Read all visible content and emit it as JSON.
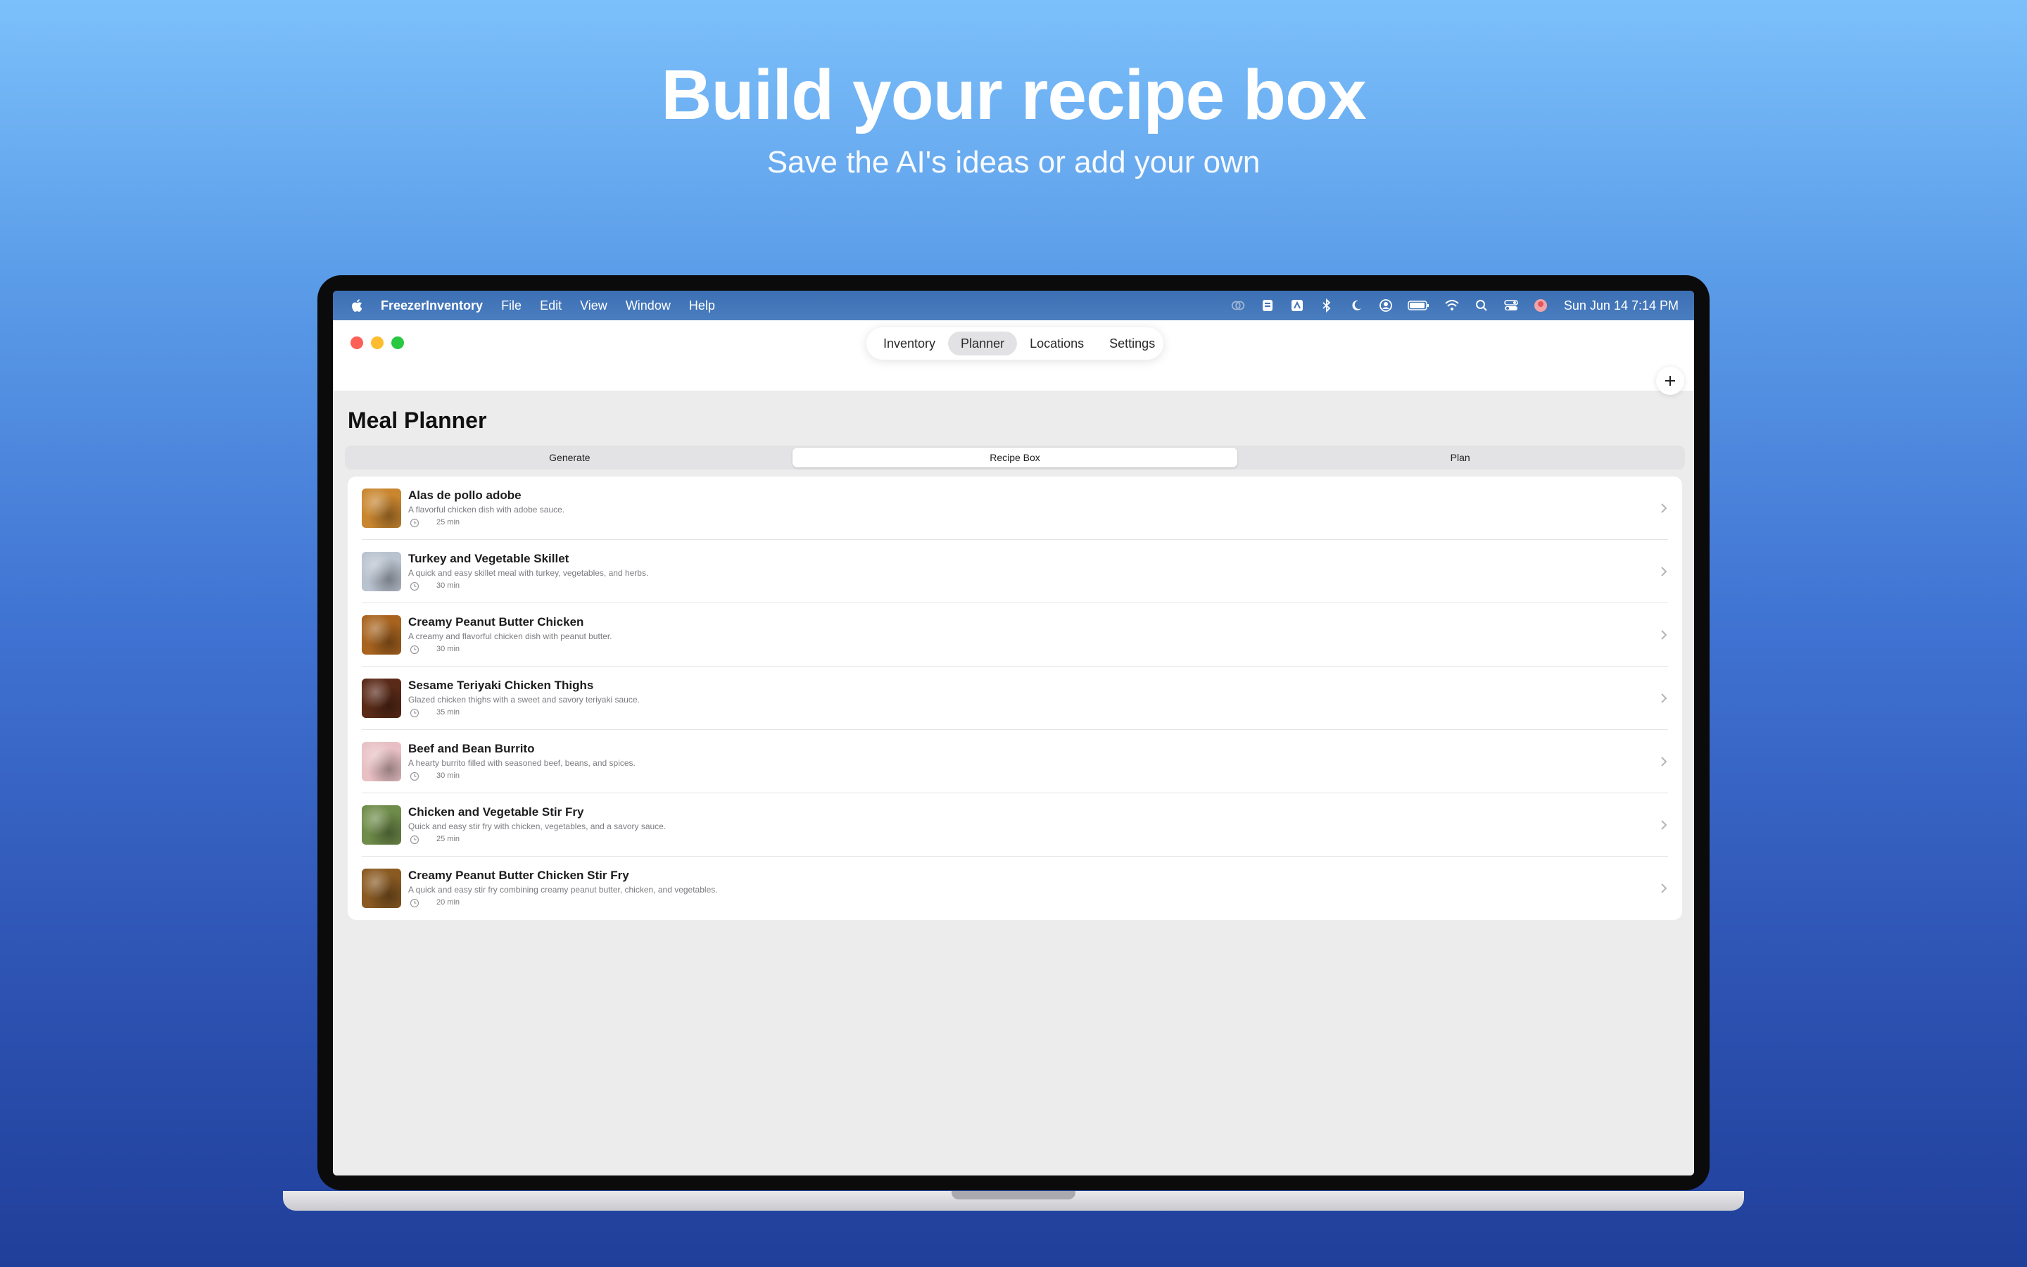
{
  "hero": {
    "title": "Build your recipe box",
    "subtitle": "Save the AI's ideas or add your own"
  },
  "menubar": {
    "app_name": "FreezerInventory",
    "menus": [
      "File",
      "Edit",
      "View",
      "Window",
      "Help"
    ],
    "status_icons": [
      "privacy-icon",
      "shield-icon",
      "app-store-icon",
      "bluetooth-icon",
      "moon-icon",
      "user-icon",
      "battery-icon",
      "wifi-icon",
      "search-icon",
      "control-center-icon",
      "avatar-icon"
    ],
    "clock": "Sun Jun 14  7:14 PM"
  },
  "nav": {
    "tabs": [
      "Inventory",
      "Planner",
      "Locations",
      "Settings"
    ],
    "active_tab": "Planner"
  },
  "page": {
    "title": "Meal Planner"
  },
  "picker": {
    "options": [
      "Generate",
      "Recipe Box",
      "Plan"
    ],
    "selected": "Recipe Box"
  },
  "recipes": [
    {
      "title": "Alas de pollo adobe",
      "description": "A flavorful chicken dish with adobe sauce.",
      "time": "25 min",
      "thumb_color": "#c9862f"
    },
    {
      "title": "Turkey and Vegetable Skillet",
      "description": "A quick and easy skillet meal with turkey, vegetables, and herbs.",
      "time": "30 min",
      "thumb_color": "#b9c2cf"
    },
    {
      "title": "Creamy Peanut Butter Chicken",
      "description": "A creamy and flavorful chicken dish with peanut butter.",
      "time": "30 min",
      "thumb_color": "#a8641f"
    },
    {
      "title": "Sesame Teriyaki Chicken Thighs",
      "description": "Glazed chicken thighs with a sweet and savory teriyaki sauce.",
      "time": "35 min",
      "thumb_color": "#5a2a18"
    },
    {
      "title": "Beef and Bean Burrito",
      "description": "A hearty burrito filled with seasoned beef, beans, and spices.",
      "time": "30 min",
      "thumb_color": "#e8c0c4"
    },
    {
      "title": "Chicken and Vegetable Stir Fry",
      "description": "Quick and easy stir fry with chicken, vegetables, and a savory sauce.",
      "time": "25 min",
      "thumb_color": "#6f8c4a"
    },
    {
      "title": "Creamy Peanut Butter Chicken Stir Fry",
      "description": "A quick and easy stir fry combining creamy peanut butter, chicken, and vegetables.",
      "time": "20 min",
      "thumb_color": "#8a5a22"
    }
  ],
  "colors": {
    "accent": "#3f72d2",
    "menubar": "#4274b8"
  }
}
